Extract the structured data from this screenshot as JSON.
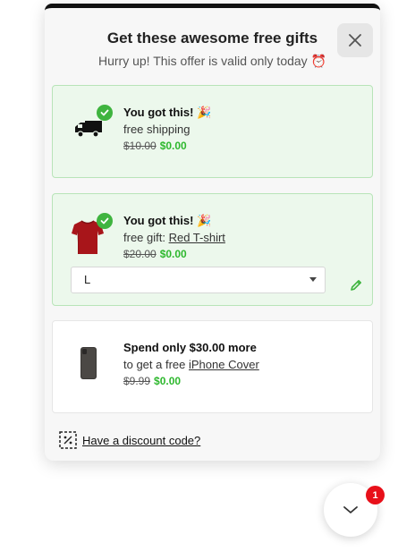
{
  "header": {
    "title": "Get these awesome free gifts",
    "subtitle": "Hurry up! This offer is valid only today ⏰"
  },
  "gifts": [
    {
      "title": "You got this! 🎉",
      "desc_prefix": "free shipping",
      "desc_link": "",
      "old_price": "$10.00",
      "new_price": "$0.00",
      "icon": "truck-icon",
      "status": "unlocked"
    },
    {
      "title": "You got this! 🎉",
      "desc_prefix": "free gift: ",
      "desc_link": "Red T-shirt",
      "old_price": "$20.00",
      "new_price": "$0.00",
      "size_value": "L",
      "icon": "tshirt-image",
      "status": "unlocked"
    },
    {
      "title": "Spend only $30.00 more",
      "desc_prefix": "to get a free ",
      "desc_link": "iPhone Cover",
      "old_price": "$9.99",
      "new_price": "$0.00",
      "icon": "phone-cover-image",
      "status": "locked"
    }
  ],
  "discount": {
    "label": "Have a discount code?"
  },
  "launcher": {
    "badge_count": "1"
  },
  "colors": {
    "unlocked_bg": "#ecf8ec",
    "unlocked_border": "#b8e4b8",
    "check_green": "#3fb43f",
    "price_green": "#2eb82e",
    "badge_red": "#e8101a"
  }
}
